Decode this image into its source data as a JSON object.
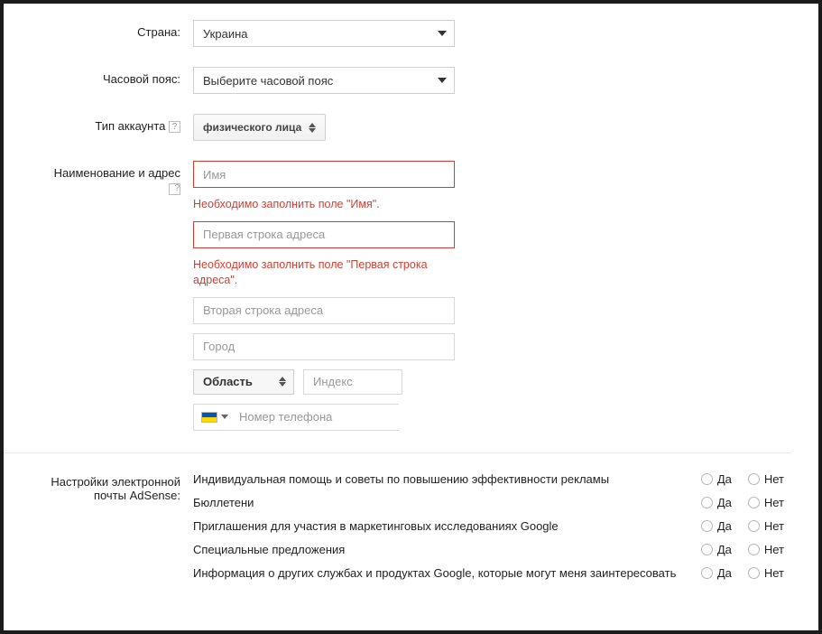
{
  "labels": {
    "country": "Страна:",
    "timezone": "Часовой пояс:",
    "account_type": "Тип аккаунта",
    "name_address": "Наименование и адрес",
    "email_prefs_l1": "Настройки электронной",
    "email_prefs_l2": "почты AdSense:"
  },
  "country": {
    "selected": "Украина"
  },
  "timezone": {
    "selected": "Выберите часовой пояс"
  },
  "account_type": {
    "selected": "физического лица"
  },
  "help_glyph": "?",
  "address": {
    "name_placeholder": "Имя",
    "name_error": "Необходимо заполнить поле \"Имя\".",
    "addr1_placeholder": "Первая строка адреса",
    "addr1_error": "Необходимо заполнить поле \"Первая строка адреса\".",
    "addr2_placeholder": "Вторая строка адреса",
    "city_placeholder": "Город",
    "region_selected": "Область",
    "zip_placeholder": "Индекс",
    "phone_placeholder": "Номер телефона"
  },
  "radio": {
    "yes": "Да",
    "no": "Нет"
  },
  "prefs": [
    "Индивидуальная помощь и советы по повышению эффективности рекламы",
    "Бюллетени",
    "Приглашения для участия в маркетинговых исследованиях Google",
    "Специальные предложения",
    "Информация о других службах и продуктах Google, которые могут меня заинтересовать"
  ]
}
